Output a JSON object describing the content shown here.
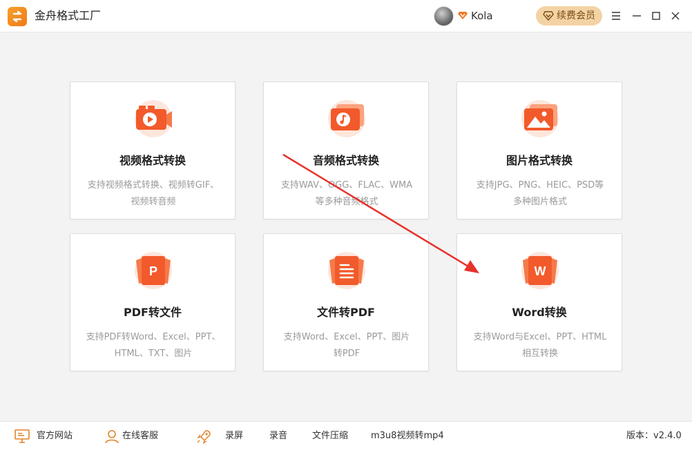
{
  "app": {
    "title": "金舟格式工厂"
  },
  "user": {
    "name": "Kola"
  },
  "header": {
    "renew_label": "续费会员"
  },
  "cards": [
    {
      "title": "视频格式转换",
      "desc_line1": "支持视频格式转换、视频转GIF、",
      "desc_line2": "视频转音频",
      "icon": "video-play-icon"
    },
    {
      "title": "音频格式转换",
      "desc_line1": "支持WAV、OGG、FLAC、WMA",
      "desc_line2": "等多种音频格式",
      "icon": "music-note-icon"
    },
    {
      "title": "图片格式转换",
      "desc_line1": "支持JPG、PNG、HEIC、PSD等",
      "desc_line2": "多种图片格式",
      "icon": "image-icon"
    },
    {
      "title": "PDF转文件",
      "desc_line1": "支持PDF转Word、Excel、PPT、",
      "desc_line2": "HTML、TXT、图片",
      "icon": "pdf-icon",
      "glyph": "P"
    },
    {
      "title": "文件转PDF",
      "desc_line1": "支持Word、Excel、PPT、图片",
      "desc_line2": "转PDF",
      "icon": "document-icon"
    },
    {
      "title": "Word转换",
      "desc_line1": "支持Word与Excel、PPT、HTML",
      "desc_line2": "相互转换",
      "icon": "word-icon",
      "glyph": "W"
    }
  ],
  "footer": {
    "official_site": "官方网站",
    "online_service": "在线客服",
    "screen_record": "录屏",
    "audio_record": "录音",
    "file_compress": "文件压缩",
    "m3u8": "m3u8视频转mp4",
    "version": "版本：v2.4.0"
  },
  "colors": {
    "accent": "#f2582a",
    "accent_light": "#fdb49a",
    "arrow": "#e8332c",
    "renew_bg": "#f3d3a4",
    "main_bg": "#f3f3f3"
  }
}
